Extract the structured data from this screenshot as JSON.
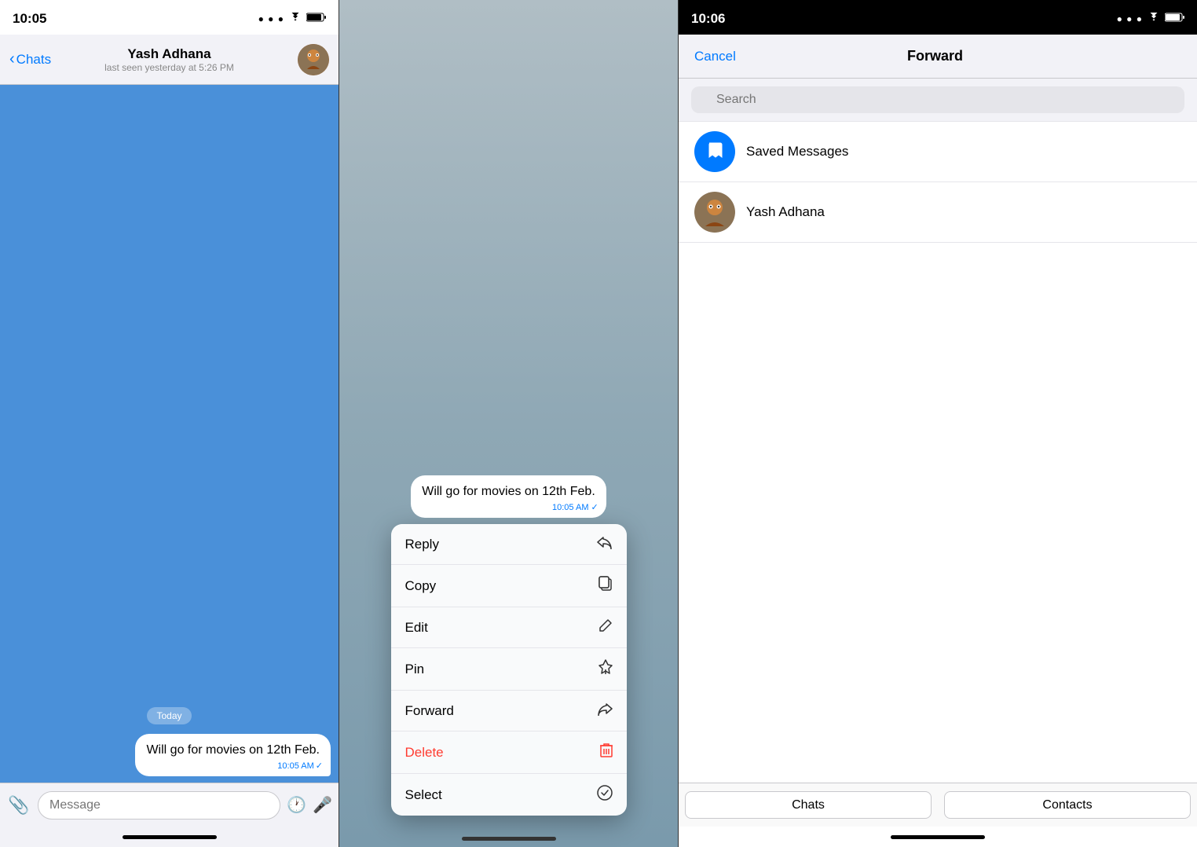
{
  "panel1": {
    "status_time": "10:05",
    "contact_name": "Yash Adhana",
    "contact_status": "last seen yesterday at 5:26 PM",
    "back_label": "Chats",
    "message_text": "Will go for movies on 12th Feb.",
    "message_time": "10:05 AM",
    "date_divider": "Today",
    "input_placeholder": "Message"
  },
  "panel2": {
    "message_text": "Will go for movies on 12th Feb.",
    "message_time": "10:05 AM",
    "menu_items": [
      {
        "label": "Reply",
        "icon": "↩",
        "color": "#000"
      },
      {
        "label": "Copy",
        "icon": "⧉",
        "color": "#000"
      },
      {
        "label": "Edit",
        "icon": "✎",
        "color": "#000"
      },
      {
        "label": "Pin",
        "icon": "📌",
        "color": "#000"
      },
      {
        "label": "Forward",
        "icon": "↪",
        "color": "#000"
      },
      {
        "label": "Delete",
        "icon": "🗑",
        "color": "#ff3b30"
      },
      {
        "label": "Select",
        "icon": "✓",
        "color": "#000"
      }
    ]
  },
  "panel3": {
    "status_time": "10:06",
    "cancel_label": "Cancel",
    "title": "Forward",
    "search_placeholder": "Search",
    "contacts": [
      {
        "name": "Saved Messages",
        "type": "saved"
      },
      {
        "name": "Yash Adhana",
        "type": "user"
      }
    ],
    "tabs": [
      {
        "label": "Chats"
      },
      {
        "label": "Contacts"
      }
    ]
  }
}
